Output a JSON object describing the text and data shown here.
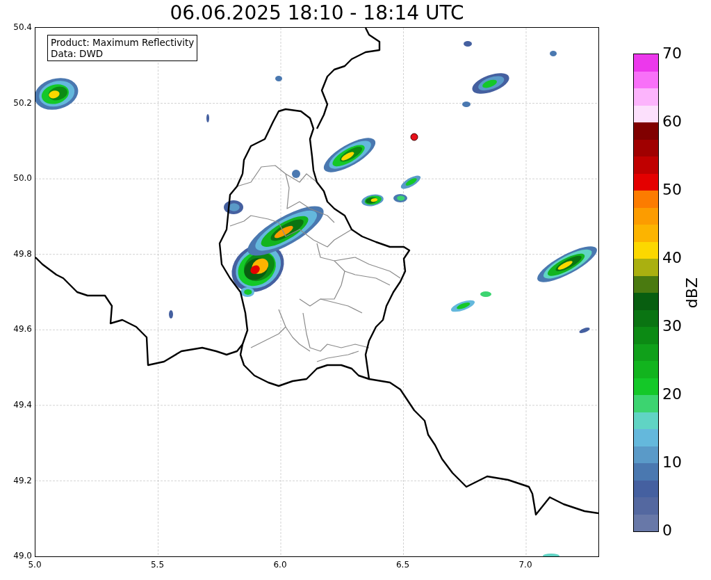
{
  "title": "06.06.2025 18:10 - 18:14 UTC",
  "info_box": {
    "lines": [
      "Product: Maximum Reflectivity",
      "Data: DWD"
    ]
  },
  "y_ticks": [
    "50.4",
    "50.2",
    "50.0",
    "49.8",
    "49.6",
    "49.4",
    "49.2",
    "49.0"
  ],
  "x_ticks": [
    "5.0",
    "5.5",
    "6.0",
    "6.5",
    "7.0"
  ],
  "colorbar": {
    "label": "dBZ",
    "ticks": [
      "70",
      "60",
      "50",
      "40",
      "30",
      "20",
      "10",
      "0"
    ],
    "segments": [
      {
        "color": "#6878a8"
      },
      {
        "color": "#5468a0"
      },
      {
        "color": "#4560a0"
      },
      {
        "color": "#4a78b0"
      },
      {
        "color": "#5a9ac8"
      },
      {
        "color": "#64b8dc"
      },
      {
        "color": "#60d4c4"
      },
      {
        "color": "#3cd470"
      },
      {
        "color": "#14c828"
      },
      {
        "color": "#12b41e"
      },
      {
        "color": "#10a01a"
      },
      {
        "color": "#0c8a14"
      },
      {
        "color": "#0a7412"
      },
      {
        "color": "#085e10"
      },
      {
        "color": "#4a7a10"
      },
      {
        "color": "#aab010"
      },
      {
        "color": "#fcd800"
      },
      {
        "color": "#fcb400"
      },
      {
        "color": "#fc9c00"
      },
      {
        "color": "#fc7c00"
      },
      {
        "color": "#e40000"
      },
      {
        "color": "#c00000"
      },
      {
        "color": "#a00000"
      },
      {
        "color": "#800000"
      },
      {
        "color": "#fce0fc"
      },
      {
        "color": "#fcb4fc"
      },
      {
        "color": "#f870f8"
      },
      {
        "color": "#ec38ec"
      }
    ]
  }
}
